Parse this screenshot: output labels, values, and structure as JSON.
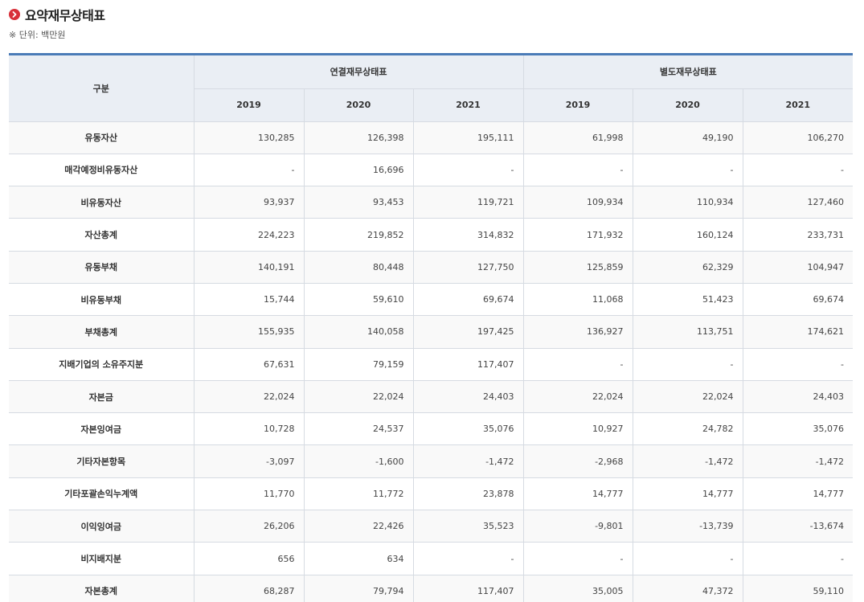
{
  "header": {
    "title": "요약재무상태표",
    "unit": "※ 단위: 백만원",
    "bullet_icon": "chevron-right-icon",
    "accent_color": "#d8303a",
    "table_top_border_color": "#4a7bb7"
  },
  "table": {
    "category_label": "구분",
    "groups": [
      "연결재무상태표",
      "별도재무상태표"
    ],
    "years": [
      "2019",
      "2020",
      "2021",
      "2019",
      "2020",
      "2021"
    ],
    "rows": [
      {
        "label": "유동자산",
        "values": [
          "130,285",
          "126,398",
          "195,111",
          "61,998",
          "49,190",
          "106,270"
        ]
      },
      {
        "label": "매각예정비유동자산",
        "values": [
          "-",
          "16,696",
          "-",
          "-",
          "-",
          "-"
        ]
      },
      {
        "label": "비유동자산",
        "values": [
          "93,937",
          "93,453",
          "119,721",
          "109,934",
          "110,934",
          "127,460"
        ]
      },
      {
        "label": "자산총계",
        "values": [
          "224,223",
          "219,852",
          "314,832",
          "171,932",
          "160,124",
          "233,731"
        ]
      },
      {
        "label": "유동부채",
        "values": [
          "140,191",
          "80,448",
          "127,750",
          "125,859",
          "62,329",
          "104,947"
        ]
      },
      {
        "label": "비유동부채",
        "values": [
          "15,744",
          "59,610",
          "69,674",
          "11,068",
          "51,423",
          "69,674"
        ]
      },
      {
        "label": "부채총계",
        "values": [
          "155,935",
          "140,058",
          "197,425",
          "136,927",
          "113,751",
          "174,621"
        ]
      },
      {
        "label": "지배기업의 소유주지분",
        "values": [
          "67,631",
          "79,159",
          "117,407",
          "-",
          "-",
          "-"
        ]
      },
      {
        "label": "자본금",
        "values": [
          "22,024",
          "22,024",
          "24,403",
          "22,024",
          "22,024",
          "24,403"
        ]
      },
      {
        "label": "자본잉여금",
        "values": [
          "10,728",
          "24,537",
          "35,076",
          "10,927",
          "24,782",
          "35,076"
        ]
      },
      {
        "label": "기타자본항목",
        "values": [
          "-3,097",
          "-1,600",
          "-1,472",
          "-2,968",
          "-1,472",
          "-1,472"
        ]
      },
      {
        "label": "기타포괄손익누계액",
        "values": [
          "11,770",
          "11,772",
          "23,878",
          "14,777",
          "14,777",
          "14,777"
        ]
      },
      {
        "label": "이익잉여금",
        "values": [
          "26,206",
          "22,426",
          "35,523",
          "-9,801",
          "-13,739",
          "-13,674"
        ]
      },
      {
        "label": "비지배지분",
        "values": [
          "656",
          "634",
          "-",
          "-",
          "-",
          "-"
        ]
      },
      {
        "label": "자본총계",
        "values": [
          "68,287",
          "79,794",
          "117,407",
          "35,005",
          "47,372",
          "59,110"
        ]
      }
    ]
  }
}
